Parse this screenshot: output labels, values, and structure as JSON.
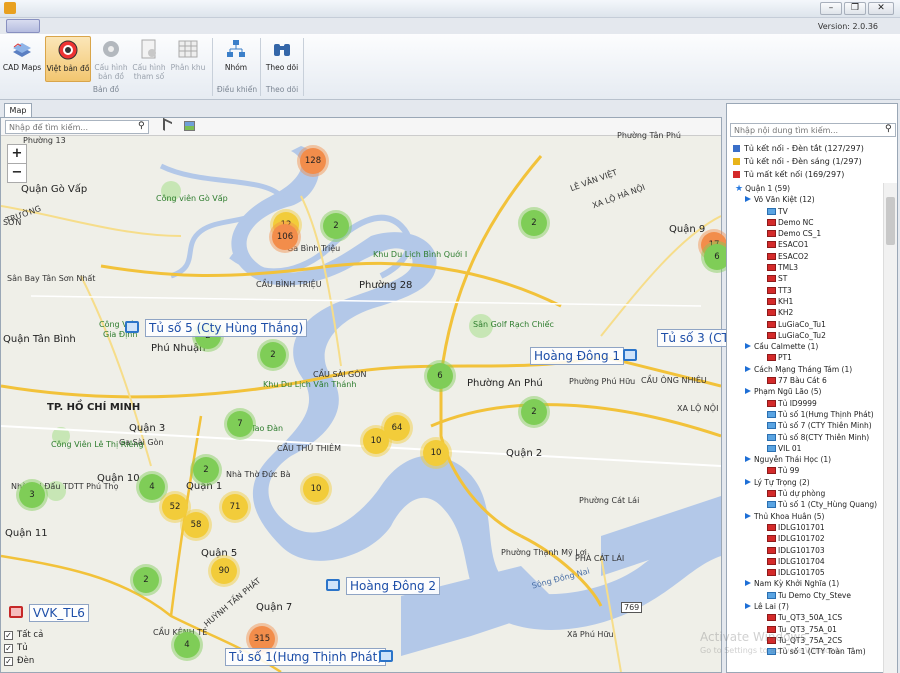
{
  "titlebar": {
    "version": "Version: 2.0.36",
    "min": "–",
    "max": "❐",
    "close": "✕"
  },
  "ribbon": {
    "buttons": [
      {
        "label": "CAD Maps"
      },
      {
        "label": "Việt bản đồ"
      },
      {
        "label": "Cấu hình bản đồ"
      },
      {
        "label": "Cấu hình tham số"
      },
      {
        "label": "Phân khu"
      },
      {
        "label": "Nhóm"
      },
      {
        "label": "Theo dõi"
      }
    ],
    "groups": [
      "Bản đồ",
      "Điều khiển",
      "Theo dõi"
    ]
  },
  "map": {
    "tab": "Map",
    "search_placeholder": "Nhập để tìm kiếm...",
    "zoom_in": "+",
    "zoom_out": "−",
    "cabinet_labels": [
      "Tủ số 5 (Cty Hùng Thắng)",
      "Hoàng Đông 1",
      "Tủ số 3 (CT",
      "Hoàng Đông 2",
      "Tủ số 1(Hưng Thịnh Phát)",
      "VVK_TL6"
    ],
    "clusters": [
      "128",
      "12",
      "106",
      "2",
      "2",
      "2",
      "2",
      "6",
      "2",
      "7",
      "10",
      "64",
      "10",
      "4",
      "52",
      "71",
      "58",
      "10",
      "90",
      "2",
      "3",
      "2",
      "4",
      "315",
      "17",
      "6"
    ],
    "places": [
      "Phường 13",
      "Quận Gò Vấp",
      "Công viên Gò Vấp",
      "Sân Bay Tân Sơn Nhất",
      "Quận Tân Bình",
      "Phú Nhuận",
      "TP. HỒ CHÍ MINH",
      "Quận 3",
      "Ga Sài Gòn",
      "Công Viên Lê Thị Riêng",
      "Quận 10",
      "Nhà Thờ Đức Bà",
      "Quận 1",
      "Quận 11",
      "Nhà Thi Đấu TDTT Phú Thọ",
      "Quận 5",
      "Quận 7",
      "Quận 2",
      "Phường 28",
      "Khu Du Lịch Bình Quới I",
      "Ga Bình Triệu",
      "CẦU BÌNH TRIỆU",
      "Sân Golf Rạch Chiếc",
      "Phường An Phú",
      "Phường Phú Hữu",
      "CẦU ÔNG NHIÊU",
      "CẦU SÀI GÒN",
      "CẦU THỦ THIÊM",
      "Khu Du Lịch Văn Thánh",
      "Phường Tân Phú",
      "Quận 9",
      "Phường Cát Lái",
      "Phường Thạnh Mỹ Lợi",
      "PHÀ CÁT LÁI",
      "Sông Đồng Nai",
      "Xã Phú Hữu",
      "CẦU KÊNH TẺ",
      "Công Viên",
      "Gia Định",
      "Tao Đàn",
      "XA LỘ HÀ NỘI",
      "LÊ VĂN VIỆT",
      "XA LỘ NỘI",
      "HUỲNH TẤN PHÁT",
      "769",
      "TRƯỜNG",
      "SƠN"
    ],
    "filter": [
      {
        "label": "Tất cả",
        "checked": true
      },
      {
        "label": "Tủ",
        "checked": true
      },
      {
        "label": "Đèn",
        "checked": true
      }
    ],
    "check_mark": "✓"
  },
  "panel": {
    "search_placeholder": "Nhập nội dung tìm kiếm...",
    "legend": [
      {
        "label": "Tủ kết nối - Đèn tắt (127/297)",
        "color": "#3a6fc9"
      },
      {
        "label": "Tủ kết nối - Đèn sáng (1/297)",
        "color": "#e8b41a"
      },
      {
        "label": "Tủ mất kết nối (169/297)",
        "color": "#d42a2a"
      }
    ],
    "tree": [
      {
        "t": "root",
        "label": "Quận 1 (59)"
      },
      {
        "t": "group",
        "label": "Võ Văn Kiệt (12)"
      },
      {
        "t": "blue",
        "label": "TV"
      },
      {
        "t": "red",
        "label": "Demo NC"
      },
      {
        "t": "red",
        "label": "Demo CS_1"
      },
      {
        "t": "red",
        "label": "ESACO1"
      },
      {
        "t": "red",
        "label": "ESACO2"
      },
      {
        "t": "red",
        "label": "TML3"
      },
      {
        "t": "red",
        "label": "ST"
      },
      {
        "t": "red",
        "label": "TT3"
      },
      {
        "t": "red",
        "label": "KH1"
      },
      {
        "t": "red",
        "label": "KH2"
      },
      {
        "t": "red",
        "label": "LuGiaCo_Tu1"
      },
      {
        "t": "red",
        "label": "LuGiaCo_Tu2"
      },
      {
        "t": "group",
        "label": "Cầu Calmette (1)"
      },
      {
        "t": "red",
        "label": "PT1"
      },
      {
        "t": "group",
        "label": "Cách Mạng Tháng Tám (1)"
      },
      {
        "t": "red",
        "label": "77 Bàu Cát 6"
      },
      {
        "t": "group",
        "label": "Phạm Ngũ Lão (5)"
      },
      {
        "t": "red",
        "label": "Tủ ID9999"
      },
      {
        "t": "blue",
        "label": "Tủ số 1(Hưng Thịnh Phát)"
      },
      {
        "t": "blue",
        "label": "Tủ số 7 (CTY Thiên Minh)"
      },
      {
        "t": "blue",
        "label": "Tủ số 8(CTY Thiên Minh)"
      },
      {
        "t": "blue",
        "label": "VIL 01"
      },
      {
        "t": "group",
        "label": "Nguyễn Thái Học (1)"
      },
      {
        "t": "red",
        "label": "Tủ 99"
      },
      {
        "t": "group",
        "label": "Lý Tự Trọng (2)"
      },
      {
        "t": "red",
        "label": "Tủ dự phòng"
      },
      {
        "t": "blue",
        "label": "Tủ số 1 (Cty_Hùng Quang)"
      },
      {
        "t": "group",
        "label": "Thủ Khoa Huân (5)"
      },
      {
        "t": "red",
        "label": "IDLG101701"
      },
      {
        "t": "red",
        "label": "IDLG101702"
      },
      {
        "t": "red",
        "label": "IDLG101703"
      },
      {
        "t": "red",
        "label": "IDLG101704"
      },
      {
        "t": "red",
        "label": "IDLG101705"
      },
      {
        "t": "group",
        "label": "Nam Kỳ Khởi Nghĩa (1)"
      },
      {
        "t": "blue",
        "label": "Tu Demo Cty_Steve"
      },
      {
        "t": "group",
        "label": "Lê Lai (7)"
      },
      {
        "t": "red",
        "label": "Tu_QT3_50A_1CS"
      },
      {
        "t": "red",
        "label": "Tu_QT3_75A_01"
      },
      {
        "t": "red",
        "label": "Tu_QT3_75A_2CS"
      },
      {
        "t": "blue",
        "label": "Tủ số 1 (CTY Toàn Tâm)"
      }
    ]
  },
  "watermark": {
    "line1": "Activate Windows",
    "line2": "Go to Settings to activate Windows."
  }
}
